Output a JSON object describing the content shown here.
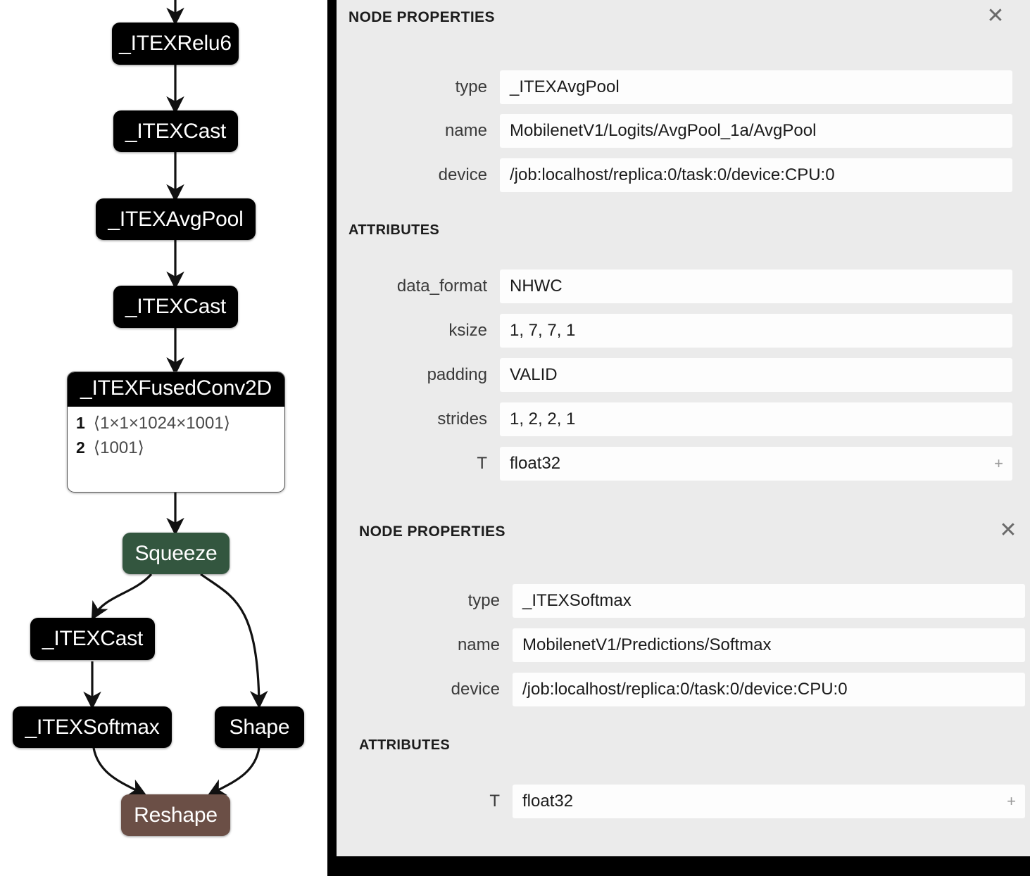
{
  "graph": {
    "nodes": [
      {
        "id": "relu6",
        "label": "_ITEXRelu6",
        "kind": "op"
      },
      {
        "id": "cast1",
        "label": "_ITEXCast",
        "kind": "op"
      },
      {
        "id": "avgpool",
        "label": "_ITEXAvgPool",
        "kind": "op"
      },
      {
        "id": "cast2",
        "label": "_ITEXCast",
        "kind": "op"
      },
      {
        "id": "squeeze",
        "label": "Squeeze",
        "kind": "green"
      },
      {
        "id": "cast3",
        "label": "_ITEXCast",
        "kind": "op"
      },
      {
        "id": "softmax",
        "label": "_ITEXSoftmax",
        "kind": "op"
      },
      {
        "id": "shape",
        "label": "Shape",
        "kind": "op"
      },
      {
        "id": "reshape",
        "label": "Reshape",
        "kind": "brown"
      }
    ],
    "fused_node": {
      "title": "_ITEXFusedConv2D",
      "rows": [
        {
          "index": "1",
          "shape": "⟨1×1×1024×1001⟩"
        },
        {
          "index": "2",
          "shape": "⟨1001⟩"
        }
      ]
    },
    "colors": {
      "op": "#000000",
      "squeeze": "#33563f",
      "reshape": "#6b4f46",
      "edge": "#111111"
    }
  },
  "panels": [
    {
      "title": "NODE PROPERTIES",
      "close_label": "✕",
      "properties": [
        {
          "label": "type",
          "value": "_ITEXAvgPool"
        },
        {
          "label": "name",
          "value": "MobilenetV1/Logits/AvgPool_1a/AvgPool"
        },
        {
          "label": "device",
          "value": "/job:localhost/replica:0/task:0/device:CPU:0"
        }
      ],
      "attributes_title": "ATTRIBUTES",
      "attributes": [
        {
          "label": "data_format",
          "value": "NHWC",
          "expand": ""
        },
        {
          "label": "ksize",
          "value": "1, 7, 7, 1",
          "expand": ""
        },
        {
          "label": "padding",
          "value": "VALID",
          "expand": ""
        },
        {
          "label": "strides",
          "value": "1, 2, 2, 1",
          "expand": ""
        },
        {
          "label": "T",
          "value": "float32",
          "expand": "+"
        }
      ]
    },
    {
      "title": "NODE PROPERTIES",
      "close_label": "✕",
      "properties": [
        {
          "label": "type",
          "value": "_ITEXSoftmax"
        },
        {
          "label": "name",
          "value": "MobilenetV1/Predictions/Softmax"
        },
        {
          "label": "device",
          "value": "/job:localhost/replica:0/task:0/device:CPU:0"
        }
      ],
      "attributes_title": "ATTRIBUTES",
      "attributes": [
        {
          "label": "T",
          "value": "float32",
          "expand": "+"
        }
      ]
    }
  ]
}
